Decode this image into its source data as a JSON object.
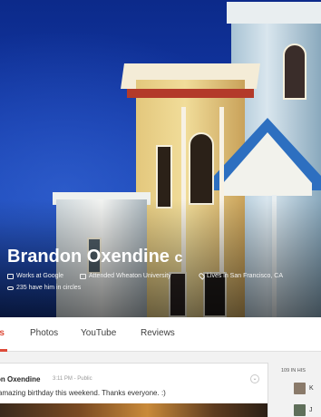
{
  "profile": {
    "name": "Brandon Oxendine",
    "verified_mark": "c",
    "details": {
      "work": "Works at Google",
      "education": "Attended Wheaton University",
      "location": "Lives in San Francisco, CA",
      "circles": "235 have him in circles"
    }
  },
  "tabs": [
    "ts",
    "Photos",
    "YouTube",
    "Reviews"
  ],
  "post": {
    "author": "on Oxendine",
    "time": "3:11 PM",
    "visibility": "Public",
    "text": "amazing birthday this weekend. Thanks everyone. :)",
    "menu_glyph": "⌄"
  },
  "side_panel": {
    "title": "109 IN HIS",
    "people": [
      {
        "name": "K"
      },
      {
        "name": "J"
      }
    ]
  },
  "colors": {
    "accent": "#dd4b39",
    "sky": "#1339a8"
  },
  "icons": {
    "work": "briefcase-icon",
    "education": "school-icon",
    "location": "location-pin-icon",
    "circles": "link-icon"
  }
}
